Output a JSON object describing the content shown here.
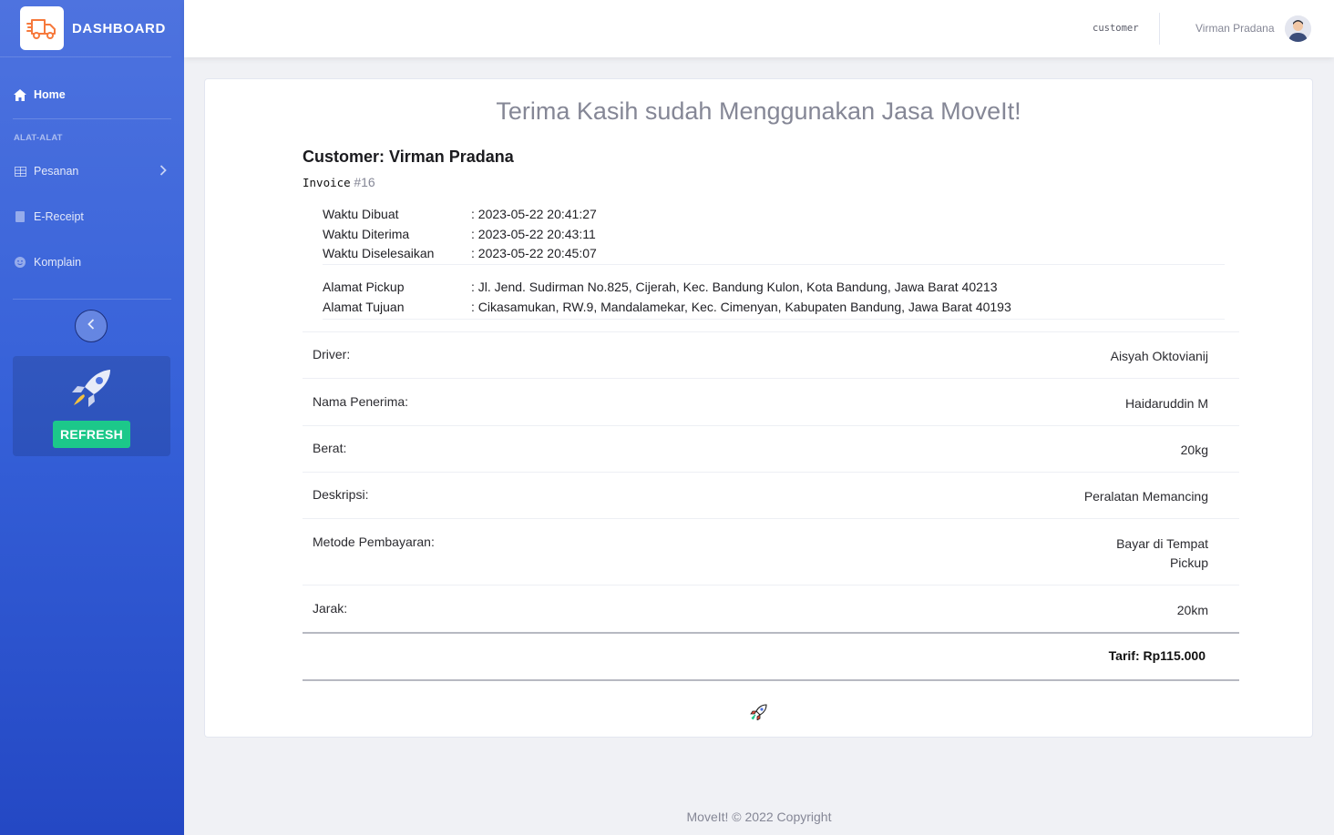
{
  "sidebar": {
    "brand": "DASHBOARD",
    "home": "Home",
    "heading": "ALAT-ALAT",
    "items": [
      {
        "label": "Pesanan",
        "icon": "table-icon"
      },
      {
        "label": "E-Receipt",
        "icon": "document-icon"
      },
      {
        "label": "Komplain",
        "icon": "smile-icon"
      }
    ],
    "refresh_label": "REFRESH"
  },
  "topbar": {
    "role": "customer",
    "username": "Virman Pradana"
  },
  "receipt": {
    "title": "Terima Kasih sudah Menggunakan Jasa MoveIt!",
    "customer_label": "Customer:",
    "customer_name": "Virman Pradana",
    "invoice_label": "Invoice",
    "invoice_number": "#16",
    "times": [
      {
        "label": "Waktu Dibuat",
        "value": ": 2023-05-22 20:41:27"
      },
      {
        "label": "Waktu Diterima",
        "value": ": 2023-05-22 20:43:11"
      },
      {
        "label": "Waktu Diselesaikan",
        "value": ": 2023-05-22 20:45:07"
      }
    ],
    "addresses": [
      {
        "label": "Alamat Pickup",
        "value": ": Jl. Jend. Sudirman No.825, Cijerah, Kec. Bandung Kulon, Kota Bandung, Jawa Barat 40213"
      },
      {
        "label": "Alamat Tujuan",
        "value": ": Cikasamukan, RW.9, Mandalamekar, Kec. Cimenyan, Kabupaten Bandung, Jawa Barat 40193"
      }
    ],
    "details": [
      {
        "label": "Driver:",
        "value": "Aisyah Oktovianij"
      },
      {
        "label": "Nama Penerima:",
        "value": "Haidaruddin M"
      },
      {
        "label": "Berat:",
        "value": "20kg"
      },
      {
        "label": "Deskripsi:",
        "value": "Peralatan Memancing"
      },
      {
        "label": "Metode Pembayaran:",
        "value_line1": "Bayar di Tempat",
        "value_line2": "Pickup"
      },
      {
        "label": "Jarak:",
        "value": "20km"
      }
    ],
    "tarif": "Tarif: Rp115.000"
  },
  "footer": "MoveIt! © 2022 Copyright",
  "colors": {
    "primary": "#4e73df",
    "success": "#1cc88a",
    "muted": "#858796",
    "brand_orange": "#f6793c"
  }
}
